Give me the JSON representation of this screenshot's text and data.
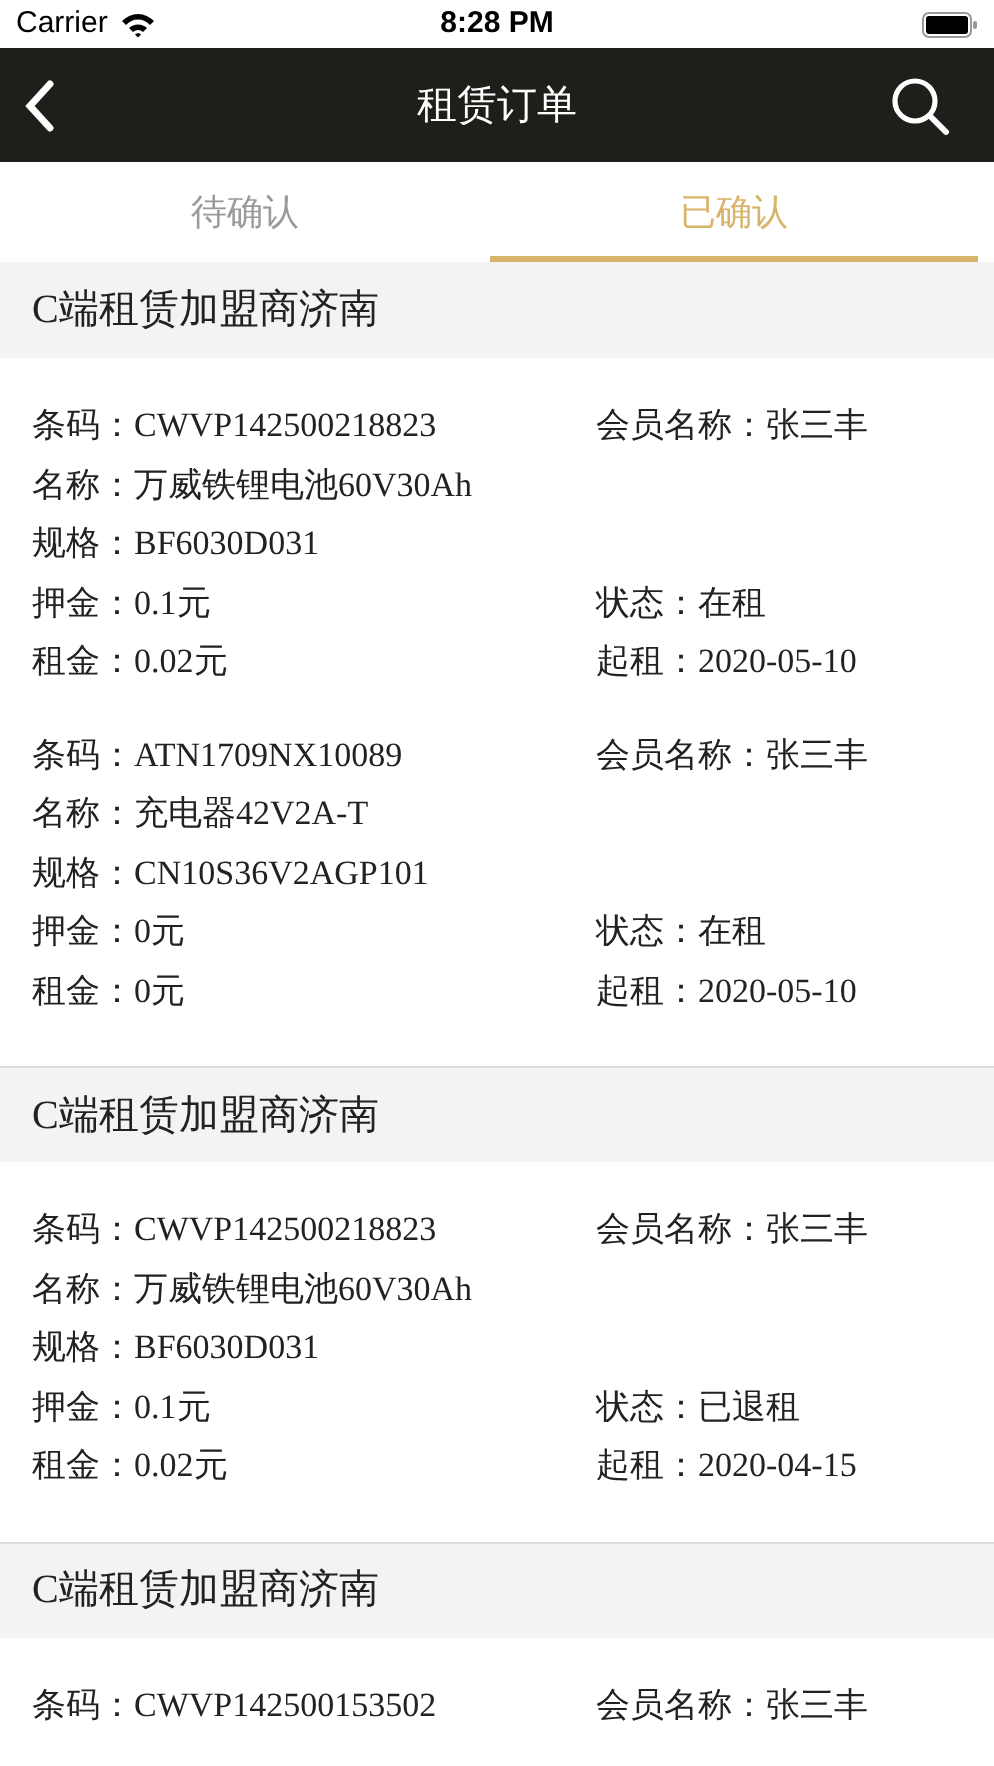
{
  "status_bar": {
    "carrier": "Carrier",
    "time": "8:28 PM"
  },
  "nav": {
    "title": "租赁订单"
  },
  "tabs": [
    {
      "label": "待确认",
      "selected": false
    },
    {
      "label": "已确认",
      "selected": true
    }
  ],
  "groups": [
    {
      "title": "C端租赁加盟商济南",
      "items": [
        {
          "rows": [
            {
              "left": "条码：CWVP142500218823",
              "right": "会员名称：张三丰"
            },
            {
              "left": "名称：万威铁锂电池60V30Ah"
            },
            {
              "left": "规格：BF6030D031"
            },
            {
              "left": "押金：0.1元",
              "right": "状态：在租"
            },
            {
              "left": "租金：0.02元",
              "right": "起租：2020-05-10"
            }
          ]
        },
        {
          "rows": [
            {
              "left": "条码：ATN1709NX10089",
              "right": "会员名称：张三丰"
            },
            {
              "left": "名称：充电器42V2A-T"
            },
            {
              "left": "规格：CN10S36V2AGP101"
            },
            {
              "left": "押金：0元",
              "right": "状态：在租"
            },
            {
              "left": "租金：0元",
              "right": "起租：2020-05-10"
            }
          ]
        }
      ]
    },
    {
      "title": "C端租赁加盟商济南",
      "items": [
        {
          "rows": [
            {
              "left": "条码：CWVP142500218823",
              "right": "会员名称：张三丰"
            },
            {
              "left": "名称：万威铁锂电池60V30Ah"
            },
            {
              "left": "规格：BF6030D031"
            },
            {
              "left": "押金：0.1元",
              "right": "状态：已退租"
            },
            {
              "left": "租金：0.02元",
              "right": "起租：2020-04-15"
            }
          ]
        }
      ]
    },
    {
      "title": "C端租赁加盟商济南",
      "items": [
        {
          "rows": [
            {
              "left": "条码：CWVP142500153502",
              "right": "会员名称：张三丰"
            }
          ]
        }
      ]
    }
  ]
}
